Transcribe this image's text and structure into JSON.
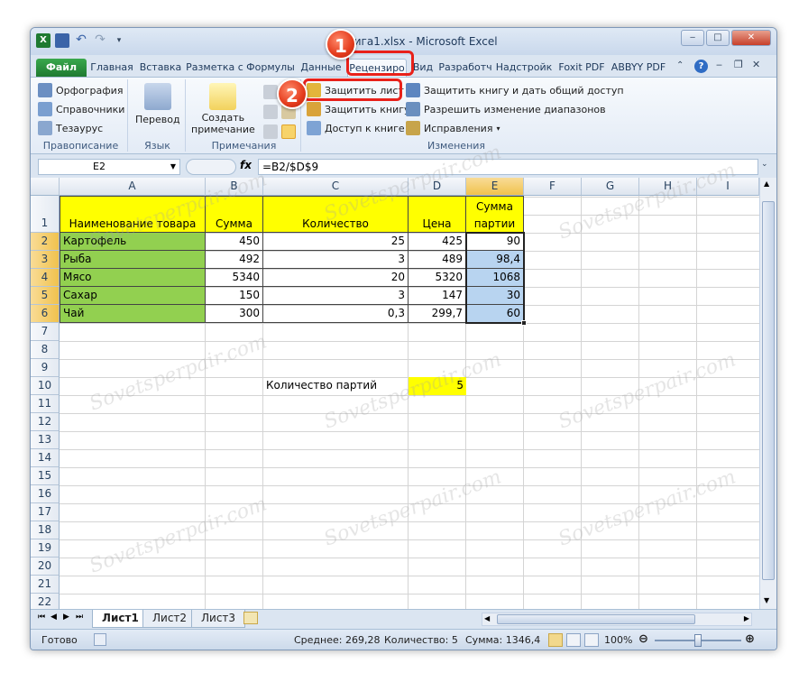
{
  "window": {
    "title": "Книга1.xlsx - Microsoft Excel",
    "min_label": "‒",
    "max_label": "□",
    "close_label": "✕"
  },
  "tabs": [
    "Файл",
    "Главная",
    "Вставка",
    "Разметка с",
    "Формулы",
    "Данные",
    "Рецензиро",
    "Вид",
    "Разработч",
    "Надстройк",
    "Foxit PDF",
    "ABBYY PDF"
  ],
  "ribbon": {
    "spelling": "Орфография",
    "references": "Справочники",
    "thesaurus": "Тезаурус",
    "group_proofing": "Правописание",
    "translate": "Перевод",
    "group_language": "Язык",
    "new_comment_1": "Создать",
    "new_comment_2": "примечание",
    "group_comments": "Примечания",
    "protect_sheet": "Защитить лист",
    "protect_workbook": "Защитить книгу",
    "share_workbook": "Доступ к книге",
    "protect_share": "Защитить книгу и дать общий доступ",
    "allow_ranges": "Разрешить изменение диапазонов",
    "track_changes": "Исправления",
    "group_changes": "Изменения"
  },
  "formula_bar": {
    "name_box": "E2",
    "fx": "fx",
    "formula": "=B2/$D$9"
  },
  "columns": [
    "A",
    "B",
    "C",
    "D",
    "E",
    "F",
    "G",
    "H",
    "I"
  ],
  "rows": [
    "1",
    "2",
    "3",
    "4",
    "5",
    "6",
    "7",
    "8",
    "9",
    "10",
    "11",
    "12",
    "13",
    "14",
    "15",
    "16",
    "17",
    "18",
    "19",
    "20",
    "21",
    "22"
  ],
  "table": {
    "headers": {
      "a": "Наименование товара",
      "b": "Сумма",
      "c": "Количество",
      "d": "Цена",
      "e1": "Сумма",
      "e2": "партии"
    },
    "data": [
      {
        "a": "Картофель",
        "b": "450",
        "c": "25",
        "d": "425",
        "e": "90"
      },
      {
        "a": "Рыба",
        "b": "492",
        "c": "3",
        "d": "489",
        "e": "98,4"
      },
      {
        "a": "Мясо",
        "b": "5340",
        "c": "20",
        "d": "5320",
        "e": "1068"
      },
      {
        "a": "Сахар",
        "b": "150",
        "c": "3",
        "d": "147",
        "e": "30"
      },
      {
        "a": "Чай",
        "b": "300",
        "c": "0,3",
        "d": "299,7",
        "e": "60"
      }
    ],
    "batch_label": "Количество партий",
    "batch_value": "5"
  },
  "sheets": [
    "Лист1",
    "Лист2",
    "Лист3"
  ],
  "status": {
    "ready": "Готово",
    "average": "Среднее: 269,28",
    "count": "Количество: 5",
    "sum": "Сумма: 1346,4",
    "zoom": "100%"
  },
  "callouts": {
    "one": "1",
    "two": "2"
  },
  "watermark": "Sovetsperpair.com",
  "colors": {
    "header_yellow": "#ffff00",
    "name_green": "#92d050",
    "selected_blue": "#b8d4f0",
    "callout_red": "#e8211a"
  }
}
